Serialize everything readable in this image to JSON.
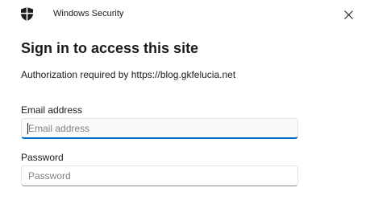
{
  "window": {
    "app_title": "Windows Security",
    "close_glyph": "✕"
  },
  "dialog": {
    "heading": "Sign in to access this site",
    "subtext": "Authorization required by https://blog.gkfelucia.net"
  },
  "form": {
    "email_label": "Email address",
    "email_placeholder": "Email address",
    "email_value": "",
    "password_label": "Password",
    "password_placeholder": "Password",
    "password_value": ""
  },
  "icons": {
    "app_icon": "shield-icon",
    "close_icon": "close-icon"
  },
  "colors": {
    "accent": "#0067c0",
    "text": "#1b1b1b",
    "placeholder": "#808080"
  }
}
